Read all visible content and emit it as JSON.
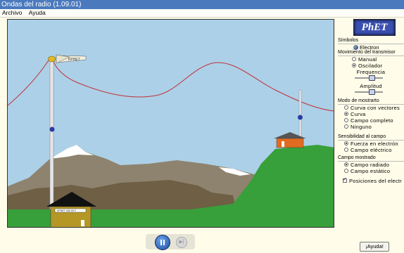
{
  "window": {
    "title": "Ondas del radio (1.09.01)"
  },
  "menu": {
    "items": [
      "Archivo",
      "Ayuda"
    ]
  },
  "scene": {
    "flag_label": "KPHET",
    "house_sign": "KPHET 000.00 F",
    "colors": {
      "sky": "#acd0e7",
      "ground": "#37a03a",
      "mountain": "#8e836e",
      "wave": "#c0303a",
      "house": "#b59726",
      "receiver_house": "#e06b21"
    }
  },
  "panel": {
    "logo": "PhET",
    "symbols": {
      "title": "Símbolos",
      "electron_label": "Electron"
    },
    "transmitter": {
      "title": "Movimiento del transmisor",
      "options": [
        {
          "label": "Manual",
          "selected": false
        },
        {
          "label": "Oscilador",
          "selected": true
        }
      ],
      "frequency_label": "Frequencia",
      "frequency_level": 0.6,
      "amplitude_label": "Amplitud",
      "amplitude_level": 0.6
    },
    "display_mode": {
      "title": "Modo de mostrarto",
      "options": [
        {
          "label": "Curva con vectores",
          "selected": false
        },
        {
          "label": "Curva",
          "selected": true
        },
        {
          "label": "Campo completo",
          "selected": false
        },
        {
          "label": "Ninguno",
          "selected": false
        }
      ]
    },
    "sense": {
      "title": "Sensibilidad al campo",
      "options": [
        {
          "label": "Fuerza en electrón",
          "selected": true
        },
        {
          "label": "Campo eléctrico",
          "selected": false
        }
      ]
    },
    "field_shown": {
      "title": "Campo mostrado",
      "options": [
        {
          "label": "Campo radiado",
          "selected": true
        },
        {
          "label": "Campo estático",
          "selected": false
        }
      ]
    },
    "positions": {
      "label": "Posiciones del electr",
      "checked": true
    }
  },
  "playback": {
    "pause_icon": "pause-icon",
    "step_icon": "step-icon"
  },
  "help_button": "¡Ayuda!"
}
